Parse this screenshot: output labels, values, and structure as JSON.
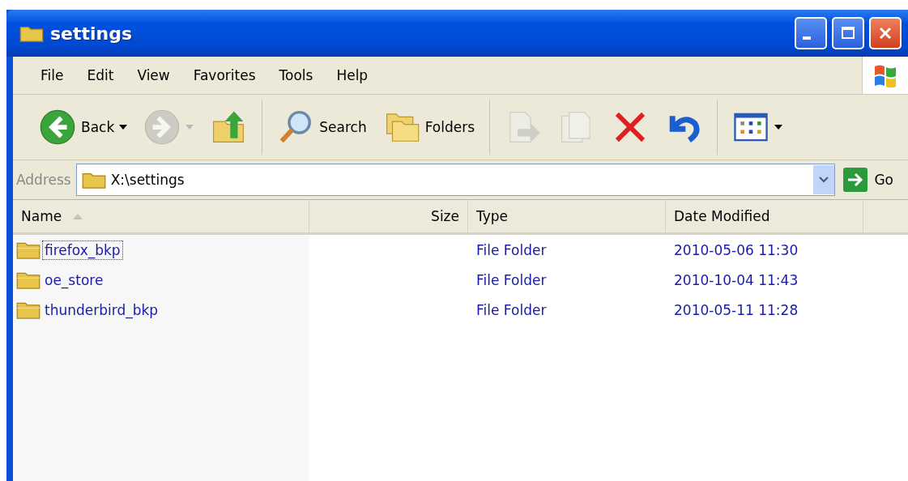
{
  "window": {
    "title": "settings"
  },
  "menu": [
    {
      "label": "File"
    },
    {
      "label": "Edit"
    },
    {
      "label": "View"
    },
    {
      "label": "Favorites"
    },
    {
      "label": "Tools"
    },
    {
      "label": "Help"
    }
  ],
  "toolbar": [
    {
      "kind": "back",
      "label": "Back",
      "disabled": false,
      "dropdown": true
    },
    {
      "kind": "forward",
      "disabled": true,
      "dropdown": true
    },
    {
      "kind": "up",
      "disabled": false,
      "dropdown": false
    },
    {
      "kind": "separator"
    },
    {
      "kind": "search",
      "label": "Search",
      "disabled": false,
      "dropdown": false
    },
    {
      "kind": "folders",
      "label": "Folders",
      "disabled": false,
      "dropdown": false
    },
    {
      "kind": "separator"
    },
    {
      "kind": "move",
      "disabled": true,
      "dropdown": false
    },
    {
      "kind": "copy",
      "disabled": true,
      "dropdown": false
    },
    {
      "kind": "delete",
      "disabled": false,
      "dropdown": false
    },
    {
      "kind": "undo",
      "disabled": false,
      "dropdown": false
    },
    {
      "kind": "separator"
    },
    {
      "kind": "views",
      "disabled": false,
      "dropdown": true
    }
  ],
  "address": {
    "label": "Address",
    "value": "X:\\settings",
    "go": "Go"
  },
  "table": {
    "columns": [
      {
        "label": "Name",
        "sorted": true
      },
      {
        "label": "Size",
        "sorted": false
      },
      {
        "label": "Type",
        "sorted": false
      },
      {
        "label": "Date Modified",
        "sorted": false
      }
    ],
    "rows": [
      {
        "name": "firefox_bkp",
        "type": "File Folder",
        "date": "2010-05-06 11:30",
        "focused": true
      },
      {
        "name": "oe_store",
        "type": "File Folder",
        "date": "2010-10-04 11:43",
        "focused": false
      },
      {
        "name": "thunderbird_bkp",
        "type": "File Folder",
        "date": "2010-05-11 11:28",
        "focused": false
      }
    ]
  }
}
